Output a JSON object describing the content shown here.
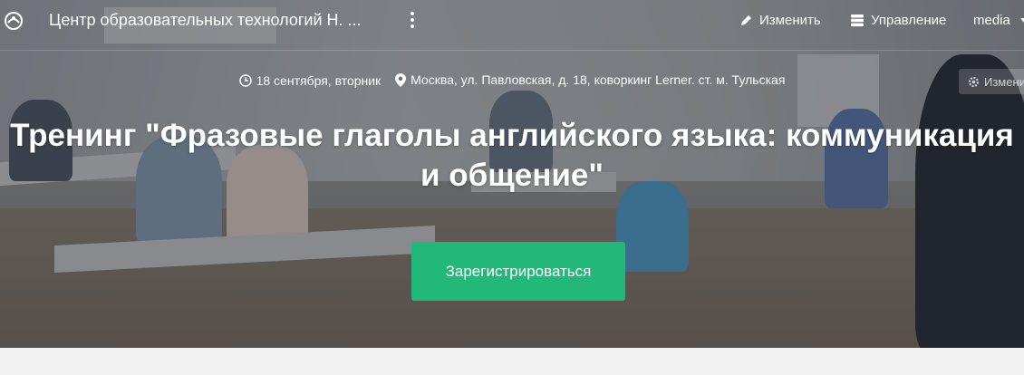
{
  "header": {
    "site_title": "Центр образовательных технологий Н. ...",
    "edit_label": "Изменить",
    "manage_label": "Управление",
    "user_label": "media"
  },
  "event": {
    "date": "18 сентября, вторник",
    "location": "Москва, ул. Павловская, д. 18, коворкинг Lerner. ст. м. Тульская",
    "title": "Тренинг \"Фразовые глаголы английского языка: коммуникация и общение\"",
    "register_label": "Зарегистрироваться",
    "edit_chip_label": "Измени"
  },
  "colors": {
    "register_button": "#22b87a",
    "overlay": "#23262d",
    "page_bg": "#f2f2f2"
  },
  "icons": {
    "brand": "brand-logo-icon",
    "more": "kebab-menu-icon",
    "edit": "pencil-icon",
    "manage": "server-stack-icon",
    "date": "clock-icon",
    "location": "map-pin-icon",
    "settings": "gear-icon"
  }
}
